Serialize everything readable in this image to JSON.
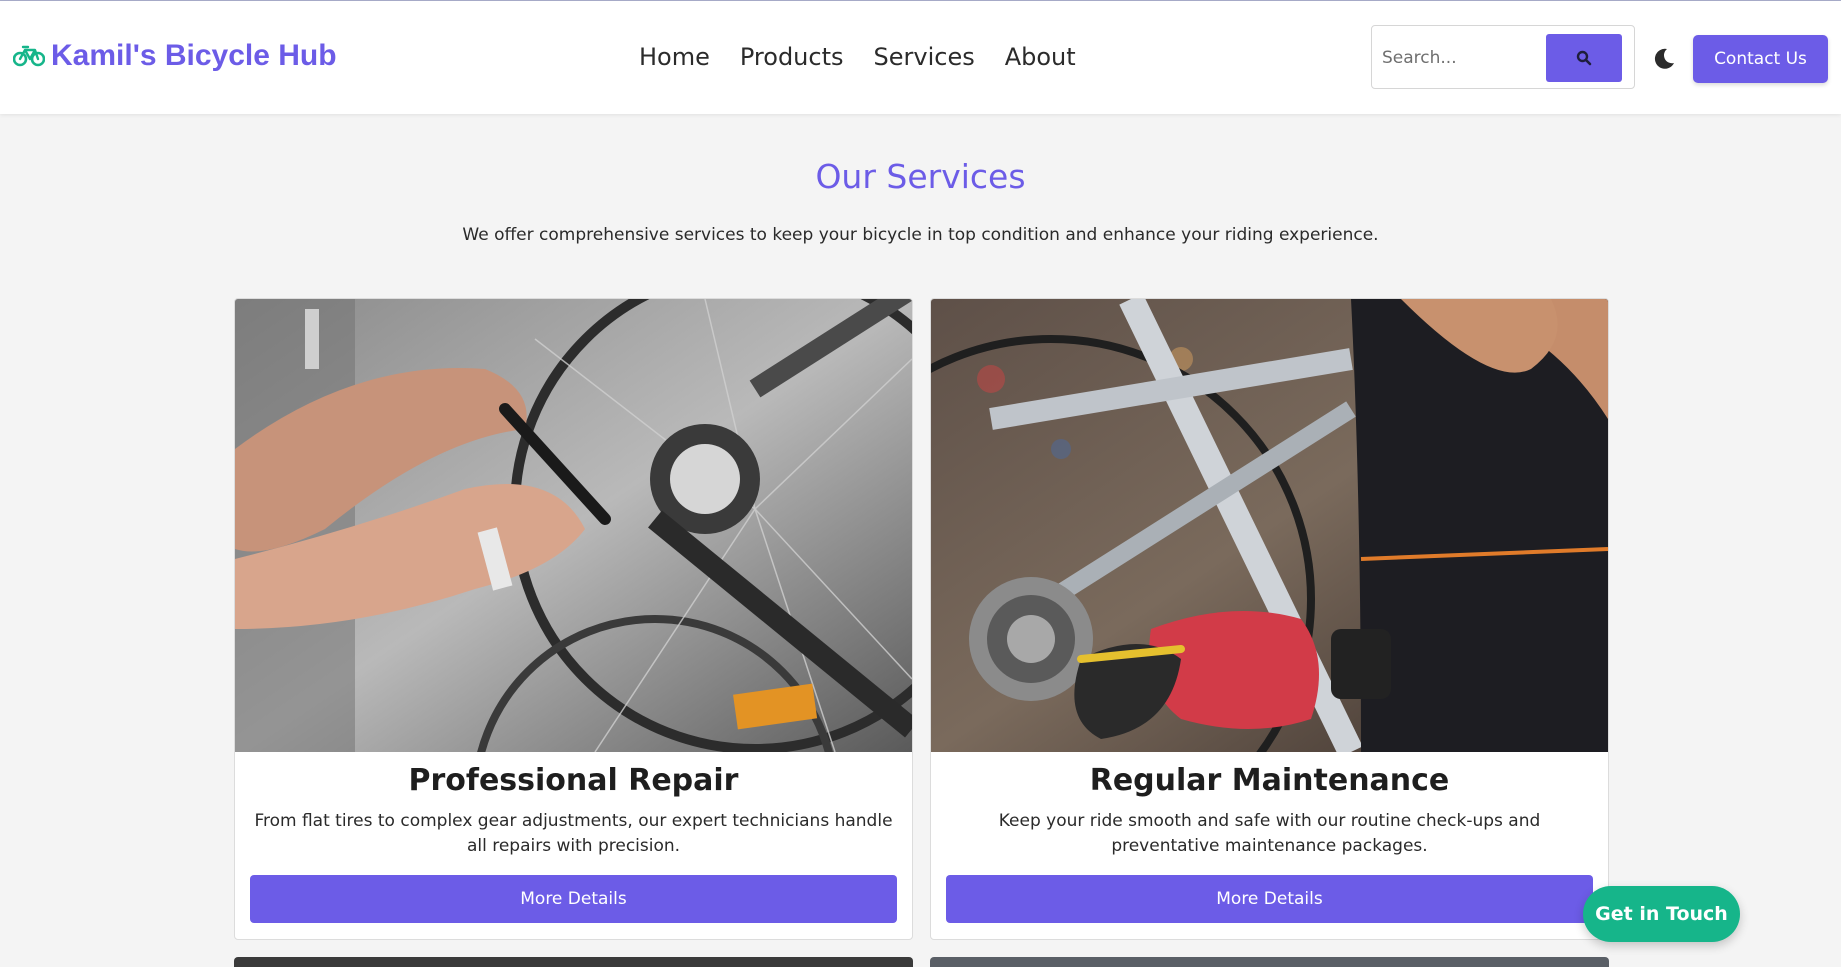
{
  "header": {
    "brand": "Kamil's Bicycle Hub",
    "brand_icon": "bicycle-icon",
    "nav": [
      "Home",
      "Products",
      "Services",
      "About"
    ],
    "search": {
      "placeholder": "Search...",
      "icon": "search-icon"
    },
    "theme_toggle_icon": "moon-icon",
    "contact_label": "Contact Us"
  },
  "services": {
    "title": "Our Services",
    "subtitle": "We offer comprehensive services to keep your bicycle in top condition and enhance your riding experience.",
    "cards": [
      {
        "image": "photo of hands repairing bicycle rear derailleur",
        "title": "Professional Repair",
        "description": "From flat tires to complex gear adjustments, our expert technicians handle all repairs with precision.",
        "button": "More Details"
      },
      {
        "image": "photo of mechanic in red gloves servicing bicycle cassette",
        "title": "Regular Maintenance",
        "description": "Keep your ride smooth and safe with our routine check-ups and preventative maintenance packages.",
        "button": "More Details"
      }
    ]
  },
  "floating_cta": "Get in Touch",
  "colors": {
    "accent": "#6c5ce7",
    "cta": "#16b58a",
    "brand_icon": "#16b58a",
    "background": "#f4f4f4"
  }
}
